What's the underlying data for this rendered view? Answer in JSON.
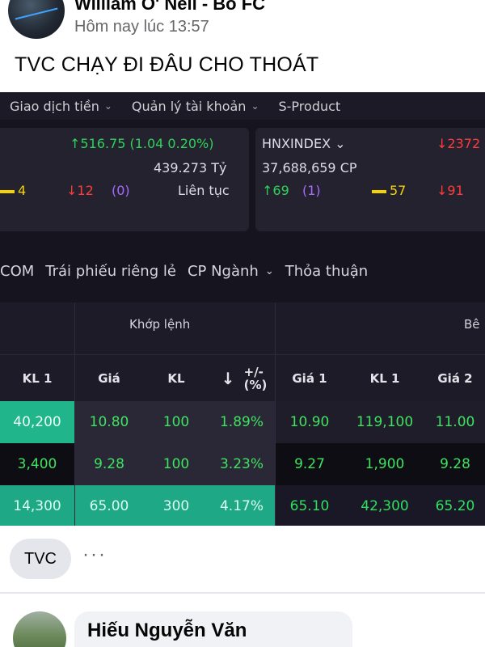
{
  "post": {
    "author": "William O' Neil - Bó FC",
    "time": "Hôm nay lúc 13:57",
    "text": "TVC CHẠY ĐI ĐÂU CHO THOÁT"
  },
  "screenshot": {
    "menu": [
      {
        "label": "Giao dịch tiền",
        "chevron": "⌄"
      },
      {
        "label": "Quản lý tài khoản",
        "chevron": "⌄"
      },
      {
        "label": "S-Product",
        "chevron": ""
      }
    ],
    "index_left": {
      "change": "↑516.75 (1.04 0.20%)",
      "value": "439.273 Tỷ",
      "status": "Liên tục",
      "up_count": "4",
      "down": "↓12",
      "ref": "(0)"
    },
    "index_right": {
      "name": "HNXINDEX",
      "chevron": "⌄",
      "volume": "37,688,659 CP",
      "up": "↑69",
      "ceiling": "(1)",
      "ref_count": "57",
      "down": "↓91",
      "far_value": "↓2372"
    },
    "subtabs": [
      {
        "label": "COM",
        "chevron": ""
      },
      {
        "label": "Trái phiếu riêng lẻ",
        "chevron": ""
      },
      {
        "label": "CP Ngành",
        "chevron": "⌄"
      },
      {
        "label": "Thỏa thuận",
        "chevron": ""
      }
    ],
    "table": {
      "group_label": "Khớp lệnh",
      "group_label_right": "Bê",
      "headers": [
        "KL 1",
        "Giá",
        "KL",
        "↓",
        "+/-\n(%)",
        "Giá 1",
        "KL 1",
        "Giá 2"
      ],
      "rows": [
        [
          "40,200",
          "10.80",
          "100",
          "1.89%",
          "10.90",
          "119,100",
          "11.00"
        ],
        [
          "3,400",
          "9.28",
          "100",
          "3.23%",
          "9.27",
          "1,900",
          "9.28"
        ],
        [
          "14,300",
          "65.00",
          "300",
          "4.17%",
          "65.10",
          "42,300",
          "65.20"
        ]
      ]
    }
  },
  "tag": {
    "label": "TVC",
    "more": "···"
  },
  "comment": {
    "name": "Hiếu Nguyễn Văn"
  },
  "colors": {
    "up_green": "#2fd25a",
    "down_red": "#ff3b3b",
    "ref_yellow": "#f5d300",
    "teal": "#20b58a"
  }
}
